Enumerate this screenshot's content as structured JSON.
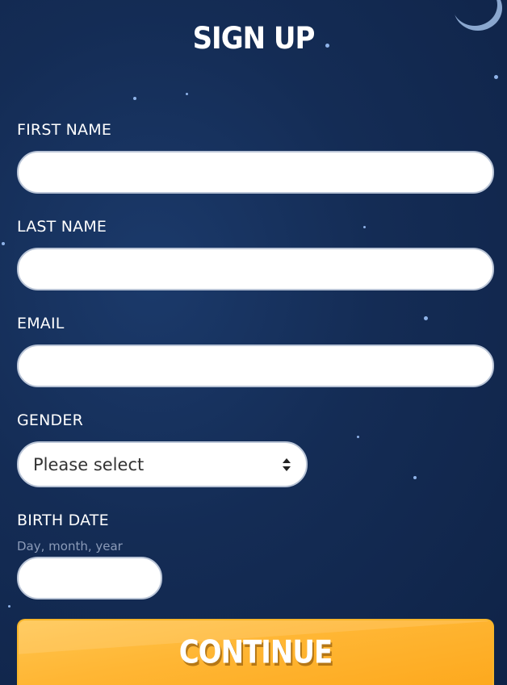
{
  "header": {
    "title": "SIGN UP"
  },
  "form": {
    "first_name": {
      "label": "FIRST NAME",
      "value": ""
    },
    "last_name": {
      "label": "LAST NAME",
      "value": ""
    },
    "email": {
      "label": "EMAIL",
      "value": ""
    },
    "gender": {
      "label": "GENDER",
      "selected": "Please select"
    },
    "birth_date": {
      "label": "BIRTH DATE",
      "hint": "Day, month, year",
      "value": ""
    }
  },
  "actions": {
    "continue_label": "CONTINUE"
  },
  "colors": {
    "background": "#142c55",
    "field_border": "#b9c4d6",
    "button": "#ffb634",
    "hint_text": "#8b9bb8"
  },
  "icons": {
    "select_arrows": "updown-icon",
    "moon": "moon-icon"
  }
}
